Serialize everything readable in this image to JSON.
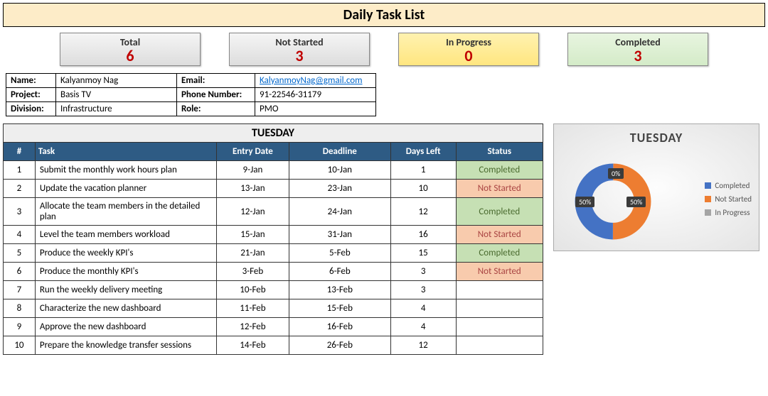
{
  "title": "Daily Task List",
  "summary": [
    {
      "label": "Total",
      "value": "6",
      "class": ""
    },
    {
      "label": "Not Started",
      "value": "3",
      "class": ""
    },
    {
      "label": "In Progress",
      "value": "0",
      "class": "yellow"
    },
    {
      "label": "Completed",
      "value": "3",
      "class": "green"
    }
  ],
  "info": {
    "name_label": "Name:",
    "name": "Kalyanmoy Nag",
    "email_label": "Email:",
    "email": "KalyanmoyNag@gmail.com",
    "project_label": "Project:",
    "project": "Basis TV",
    "phone_label": "Phone Number:",
    "phone": "91-22546-31179",
    "division_label": "Division:",
    "division": "Infrastructure",
    "role_label": "Role:",
    "role": "PMO"
  },
  "day": "TUESDAY",
  "columns": {
    "num": "#",
    "task": "Task",
    "entry": "Entry Date",
    "deadline": "Deadline",
    "days": "Days Left",
    "status": "Status"
  },
  "tasks": [
    {
      "n": "1",
      "task": "Submit the monthly work hours plan",
      "entry": "9-Jan",
      "deadline": "10-Jan",
      "days": "1",
      "status": "Completed"
    },
    {
      "n": "2",
      "task": "Update the vacation planner",
      "entry": "13-Jan",
      "deadline": "23-Jan",
      "days": "10",
      "status": "Not Started"
    },
    {
      "n": "3",
      "task": "Allocate the team members in the detailed plan",
      "entry": "12-Jan",
      "deadline": "24-Jan",
      "days": "12",
      "status": "Completed"
    },
    {
      "n": "4",
      "task": "Level the team members workload",
      "entry": "15-Jan",
      "deadline": "31-Jan",
      "days": "16",
      "status": "Not Started"
    },
    {
      "n": "5",
      "task": "Produce the weekly KPI's",
      "entry": "21-Jan",
      "deadline": "5-Feb",
      "days": "15",
      "status": "Completed"
    },
    {
      "n": "6",
      "task": "Produce the monthly KPI's",
      "entry": "3-Feb",
      "deadline": "6-Feb",
      "days": "3",
      "status": "Not Started"
    },
    {
      "n": "7",
      "task": "Run the weekly delivery meeting",
      "entry": "10-Feb",
      "deadline": "13-Feb",
      "days": "3",
      "status": ""
    },
    {
      "n": "8",
      "task": "Characterize the new dashboard",
      "entry": "11-Feb",
      "deadline": "15-Feb",
      "days": "4",
      "status": ""
    },
    {
      "n": "9",
      "task": "Approve the new dashboard",
      "entry": "12-Feb",
      "deadline": "16-Feb",
      "days": "4",
      "status": ""
    },
    {
      "n": "10",
      "task": "Prepare the knowledge transfer sessions",
      "entry": "14-Feb",
      "deadline": "26-Feb",
      "days": "12",
      "status": ""
    }
  ],
  "chart_data": {
    "type": "pie",
    "title": "TUESDAY",
    "series": [
      {
        "name": "Completed",
        "value": 50,
        "label": "50%",
        "color": "#4472c4"
      },
      {
        "name": "Not Started",
        "value": 50,
        "label": "50%",
        "color": "#ed7d31"
      },
      {
        "name": "In Progress",
        "value": 0,
        "label": "0%",
        "color": "#a5a5a5"
      }
    ],
    "legend": [
      "Completed",
      "Not Started",
      "In Progress"
    ],
    "donut": true
  }
}
